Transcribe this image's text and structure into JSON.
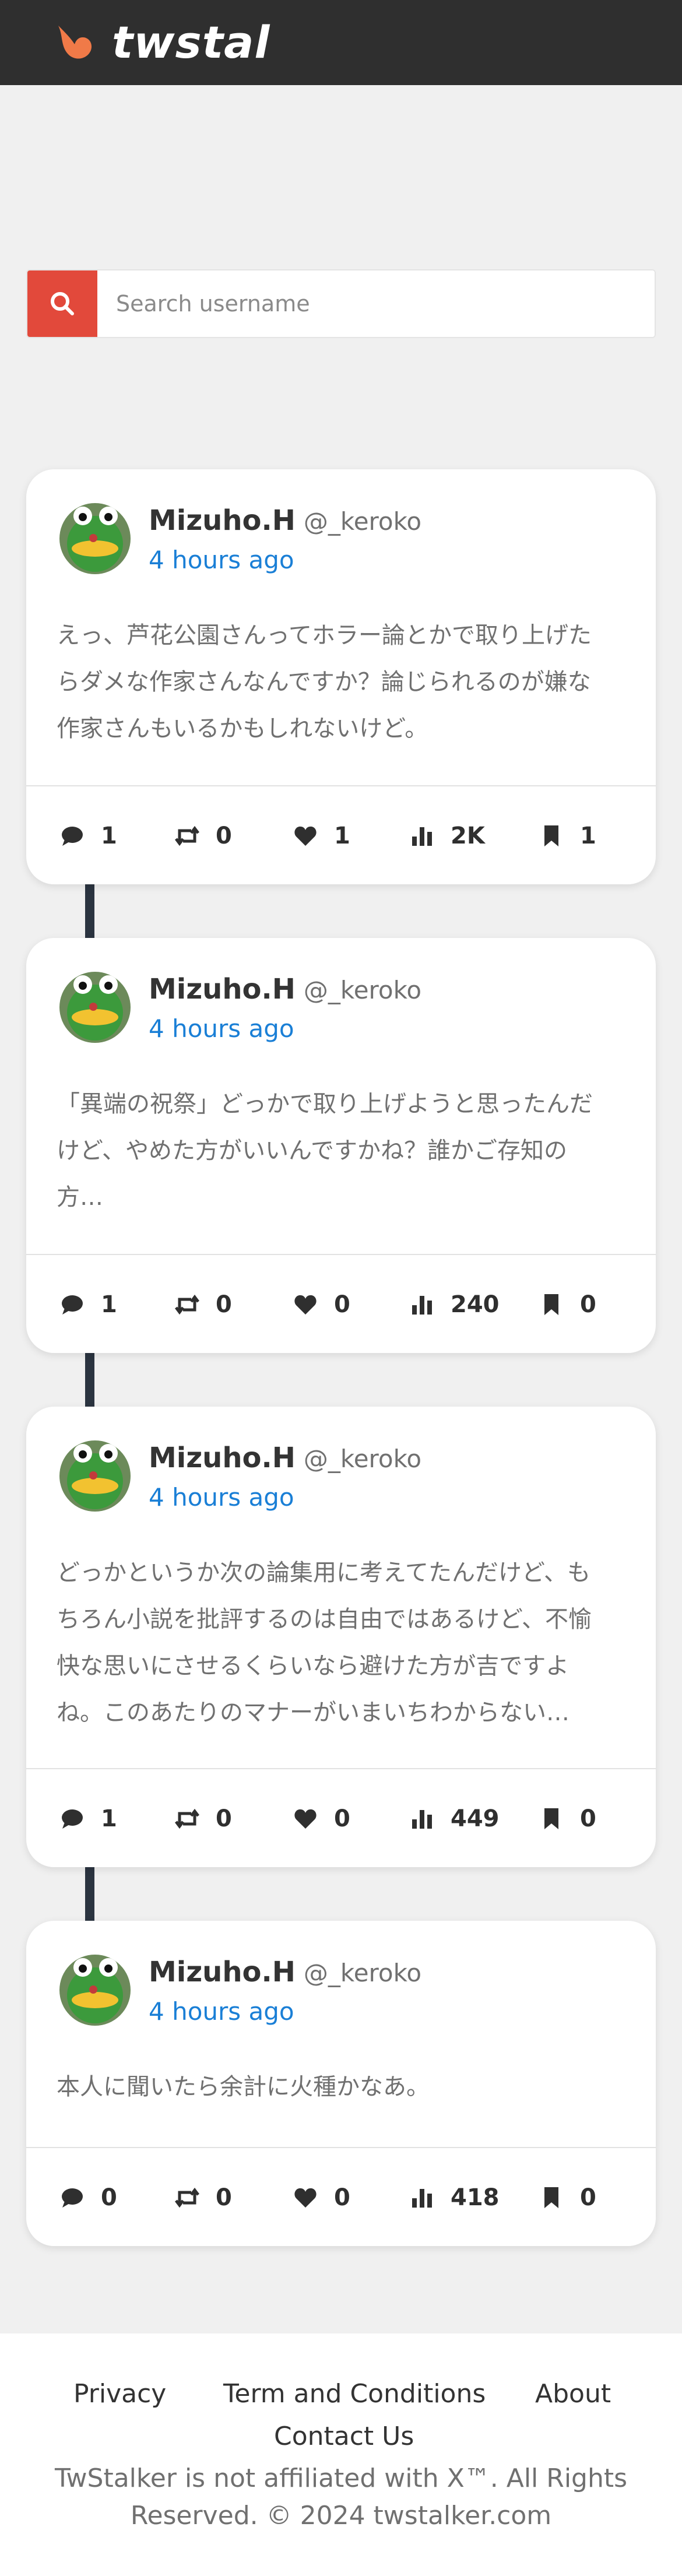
{
  "header": {
    "brand": "twstalker"
  },
  "search": {
    "placeholder": "Search username"
  },
  "posts": [
    {
      "name": "Mizuho.H",
      "handle": "@_keroko",
      "time": "4 hours ago",
      "lines": [
        "えっ、芦花公園さんってホラー論とかで取り上げた",
        "らダメな作家さんなんですか？論じられるのが嫌な",
        "作家さんもいるかもしれないけど。"
      ],
      "stats": {
        "replies": "1",
        "retweets": "0",
        "likes": "1",
        "views": "2K",
        "bookmarks": "1"
      }
    },
    {
      "name": "Mizuho.H",
      "handle": "@_keroko",
      "time": "4 hours ago",
      "lines": [
        "「異端の祝祭」どっかで取り上げようと思ったんだ",
        "けど、やめた方がいいんですかね？誰かご存知の",
        "方…"
      ],
      "stats": {
        "replies": "1",
        "retweets": "0",
        "likes": "0",
        "views": "240",
        "bookmarks": "0"
      }
    },
    {
      "name": "Mizuho.H",
      "handle": "@_keroko",
      "time": "4 hours ago",
      "lines": [
        "どっかというか次の論集用に考えてたんだけど、も",
        "ちろん小説を批評するのは自由ではあるけど、不愉",
        "快な思いにさせるくらいなら避けた方が吉ですよ",
        "ね。このあたりのマナーがいまいちわからない…"
      ],
      "stats": {
        "replies": "1",
        "retweets": "0",
        "likes": "0",
        "views": "449",
        "bookmarks": "0"
      }
    },
    {
      "name": "Mizuho.H",
      "handle": "@_keroko",
      "time": "4 hours ago",
      "lines": [
        "本人に聞いたら余計に火種かなあ。"
      ],
      "stats": {
        "replies": "0",
        "retweets": "0",
        "likes": "0",
        "views": "418",
        "bookmarks": "0"
      }
    }
  ],
  "footer": {
    "privacy": "Privacy",
    "terms": "Term and Conditions",
    "about": "About",
    "contact": "Contact Us",
    "copy_line1": "TwStalker is not affiliated with X™. All Rights",
    "copy_line2": "Reserved. © 2024 twstalker.com"
  },
  "colors": {
    "accent": "#e2493b",
    "link": "#1a7fd6",
    "topbar": "#2f2f2f",
    "thread_line": "#2b3440"
  },
  "icons": [
    "search-icon",
    "comment-icon",
    "retweet-icon",
    "heart-icon",
    "views-icon",
    "bookmark-icon"
  ]
}
